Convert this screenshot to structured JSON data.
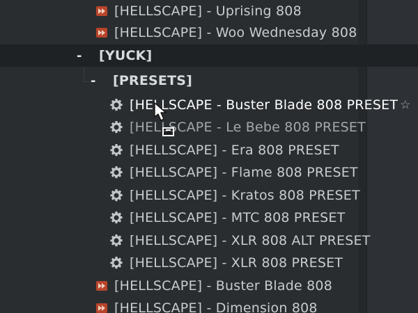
{
  "browser": {
    "rows": [
      {
        "type": "sample",
        "label": "[HELLSCAPE] - Uprising 808"
      },
      {
        "type": "sample",
        "label": "[HELLSCAPE] - Woo Wednesday 808"
      },
      {
        "type": "folder",
        "label": "[YUCK]"
      },
      {
        "type": "subfolder",
        "label": "[PRESETS]"
      },
      {
        "type": "preset",
        "label": "[HELLSCAPE - Buster Blade 808 PRESET"
      },
      {
        "type": "preset",
        "label": "[HELLSCAPE - Le Bebe 808 PRESET"
      },
      {
        "type": "preset",
        "label": "[HELLSCAPE] - Era 808 PRESET"
      },
      {
        "type": "preset",
        "label": "[HELLSCAPE] - Flame 808 PRESET"
      },
      {
        "type": "preset",
        "label": "[HELLSCAPE] - Kratos 808 PRESET"
      },
      {
        "type": "preset",
        "label": "[HELLSCAPE] - MTC 808 PRESET"
      },
      {
        "type": "preset",
        "label": "[HELLSCAPE] - XLR 808 ALT PRESET"
      },
      {
        "type": "preset",
        "label": "[HELLSCAPE] - XLR 808 PRESET"
      },
      {
        "type": "sample",
        "label": "[HELLSCAPE] - Buster Blade 808"
      },
      {
        "type": "sample",
        "label": "[HELLSCAPE] - Dimension 808"
      }
    ],
    "folder_toggle": "-",
    "subfolder_toggle": "-",
    "favorite_star": "☆"
  },
  "icons": {
    "sample": "sample-icon",
    "preset": "gear-icon",
    "favorite": "star-icon"
  },
  "colors": {
    "background": "#2a2d30",
    "open_folder_bg": "#1f2224",
    "sample_icon": "#b8442a",
    "text": "#c9cccf"
  }
}
